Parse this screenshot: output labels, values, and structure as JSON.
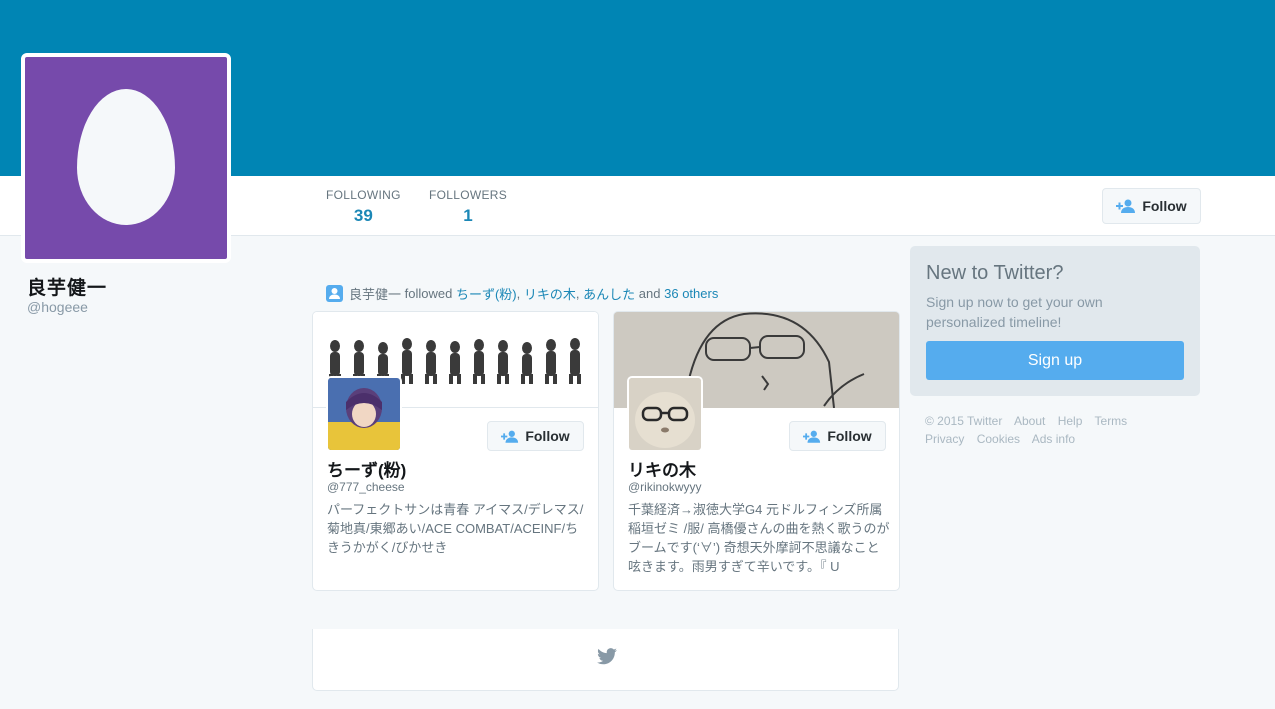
{
  "profile": {
    "name": "良芋健一",
    "handle": "@hogeee"
  },
  "stats": {
    "following_label": "FOLLOWING",
    "following_value": "39",
    "followers_label": "FOLLOWERS",
    "followers_value": "1"
  },
  "profile_follow_label": "Follow",
  "activity": {
    "actor": "良芋健一",
    "verb": "followed",
    "names": [
      "ちーず(粉)",
      "リキの木",
      "あんした"
    ],
    "and": "and",
    "others": "36 others",
    "sep": ","
  },
  "cards": [
    {
      "name": "ちーず(粉)",
      "handle": "@777_cheese",
      "bio": "パーフェクトサンは青春 アイマス/デレマス/菊地真/東郷あい/ACE COMBAT/ACEINF/ちきうかがく/びかせき",
      "follow_label": "Follow"
    },
    {
      "name": "リキの木",
      "handle": "@rikinokwyyy",
      "bio": "千葉経済→淑徳大学G4 元ドルフィンズ所属 稲垣ゼミ /服/ 高橋優さんの曲を熱く歌うのがブームです(‘∀’) 奇想天外摩訶不思議なこと呟きます。雨男すぎて辛いです。『 U",
      "follow_label": "Follow"
    }
  ],
  "signup": {
    "title": "New to Twitter?",
    "text": "Sign up now to get your own personalized timeline!",
    "button": "Sign up"
  },
  "footer": {
    "row1": [
      "© 2015 Twitter",
      "About",
      "Help",
      "Terms"
    ],
    "row2": [
      "Privacy",
      "Cookies",
      "Ads info"
    ]
  },
  "colors": {
    "banner": "#0085b4",
    "avatar_bg": "#764aab",
    "link": "#1b87b6",
    "accent": "#55acee"
  },
  "icons": [
    "egg-avatar",
    "add-user-icon",
    "person-icon",
    "bird-icon"
  ]
}
